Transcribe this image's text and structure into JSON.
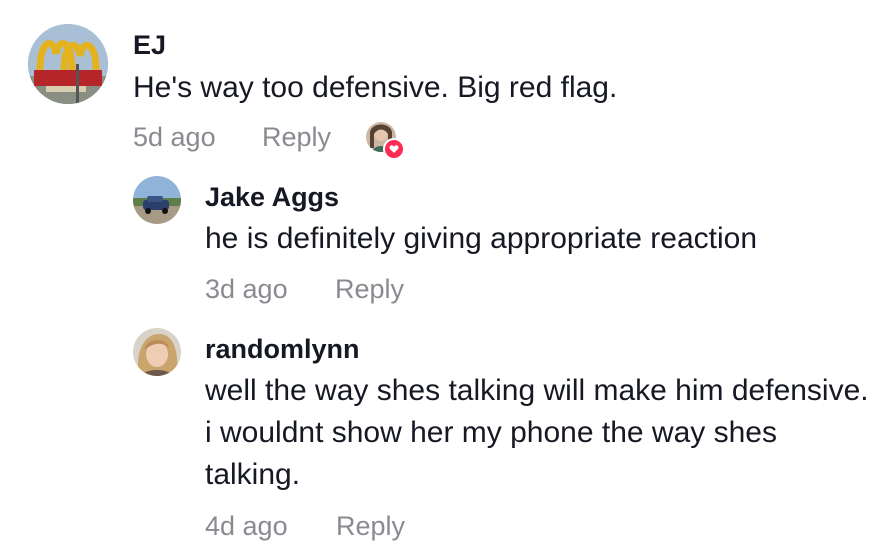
{
  "comments": [
    {
      "username": "EJ",
      "text": "He's way too defensive. Big red flag.",
      "time": "5d ago",
      "reply_label": "Reply",
      "avatar_icon": "mcdonalds-sign-avatar",
      "liked_by_creator": true
    },
    {
      "username": "Jake Aggs",
      "text": "he is definitely giving appropriate reaction",
      "time": "3d ago",
      "reply_label": "Reply",
      "avatar_icon": "car-photo-avatar"
    },
    {
      "username": "randomlynn",
      "text": "well the way shes talking will make him defensive. i wouldnt show her my phone the way shes talking.",
      "time": "4d ago",
      "reply_label": "Reply",
      "avatar_icon": "woman-photo-avatar"
    }
  ],
  "colors": {
    "text": "#161823",
    "meta": "#8a8b91",
    "heart": "#fe2c55"
  }
}
